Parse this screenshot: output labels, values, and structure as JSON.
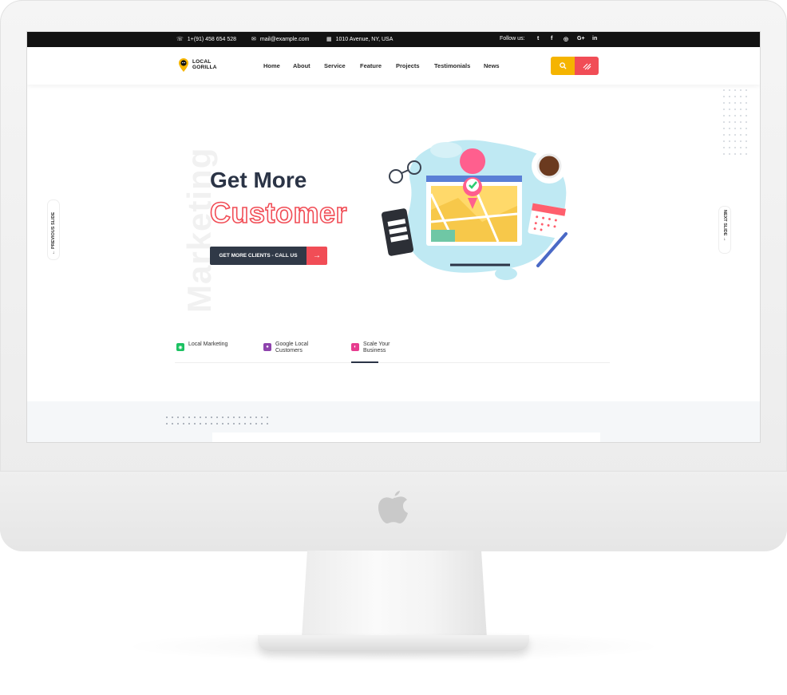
{
  "topbar": {
    "phone": "1+(91) 458 654 528",
    "email": "mail@example.com",
    "address": "1010 Avenue, NY, USA",
    "follow_label": "Follow us:",
    "social": [
      "t",
      "f",
      "◎",
      "G+",
      "in"
    ]
  },
  "header": {
    "logo_line1": "LOCAL",
    "logo_line2": "GORILLA",
    "nav": [
      "Home",
      "About",
      "Service",
      "Feature",
      "Projects",
      "Testimonials",
      "News"
    ]
  },
  "hero": {
    "side_word": "Marketing",
    "title": "Get More",
    "subtitle": "Customer",
    "cta_label": "GET MORE CLIENTS - CALL US",
    "cta_arrow": "→",
    "prev_label": "← PREVIOUS SLIDE",
    "next_label": "NEXT SLIDE →"
  },
  "tabs": [
    {
      "label": "Local Marketing",
      "color": "#1cc262"
    },
    {
      "label": "Google Local Customers",
      "color": "#8e44ad"
    },
    {
      "label": "Scale Your Business",
      "color": "#e73c8f"
    }
  ],
  "colors": {
    "accent": "#f14d56",
    "dark": "#2b3446",
    "yellow": "#f5b400"
  },
  "icons": {
    "search": "search-icon",
    "menu": "menu-stripes-icon",
    "apple": "apple-logo"
  }
}
